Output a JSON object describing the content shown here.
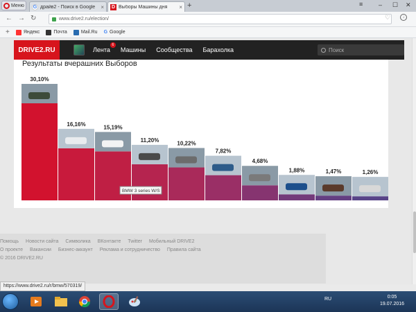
{
  "browser": {
    "menu_label": "Меню",
    "tabs": [
      {
        "title": "драйв2 - Поиск в Google",
        "favicon": "google-icon",
        "active": false
      },
      {
        "title": "Выборы Машины дня",
        "favicon": "drive2-icon",
        "active": true
      }
    ],
    "url": "www.drive2.ru/election/",
    "bookmarks": [
      {
        "label": "Яндекс",
        "icon": "yandex-icon",
        "color": "#ff0000"
      },
      {
        "label": "Почта",
        "icon": "mail-icon",
        "color": "#333333"
      },
      {
        "label": "Mail.Ru",
        "icon": "mailru-icon",
        "color": "#2a6cb0"
      },
      {
        "label": "Google",
        "icon": "google-icon",
        "color": "#4285f4"
      }
    ],
    "status_url": "https://www.drive2.ru/r/bmw/570319/"
  },
  "site": {
    "logo": "DRIVE2.RU",
    "nav": [
      {
        "label": "Лента",
        "badge": "6"
      },
      {
        "label": "Машины"
      },
      {
        "label": "Сообщества"
      },
      {
        "label": "Барахолка"
      }
    ],
    "search_placeholder": "Поиск"
  },
  "page": {
    "title": "Результаты вчерашних Выборов",
    "tooltip": "BMW 3 series W/S"
  },
  "chart_data": {
    "type": "bar",
    "title": "Результаты вчерашних Выборов",
    "categories": [
      "1",
      "2",
      "3",
      "4",
      "5",
      "6",
      "7",
      "8",
      "9",
      "10"
    ],
    "value_labels": [
      "30,10%",
      "16,16%",
      "15,19%",
      "11,20%",
      "10,22%",
      "7,82%",
      "4,68%",
      "1,88%",
      "1,47%",
      "1,26%"
    ],
    "values": [
      30.1,
      16.16,
      15.19,
      11.2,
      10.22,
      7.82,
      4.68,
      1.88,
      1.47,
      1.26
    ],
    "colors": [
      "#d2122e",
      "#c81a3c",
      "#bf1f44",
      "#b5244f",
      "#a92a5a",
      "#9a2f66",
      "#863470",
      "#733a7a",
      "#643f82",
      "#584488"
    ],
    "ylim": [
      0,
      30.1
    ]
  },
  "footer": {
    "row1": [
      "Помощь",
      "Новости сайта",
      "Символика",
      "ВКонтакте",
      "Twitter",
      "Мобильный DRIVE2"
    ],
    "row2": [
      "О проекте",
      "Вакансии",
      "Бизнес-аккаунт",
      "Реклама и сотрудничество",
      "Правила сайта"
    ],
    "copyright": "© 2016 DRIVE2.RU"
  },
  "taskbar": {
    "language": "RU",
    "time": "0:05",
    "date": "19.07.2016"
  }
}
